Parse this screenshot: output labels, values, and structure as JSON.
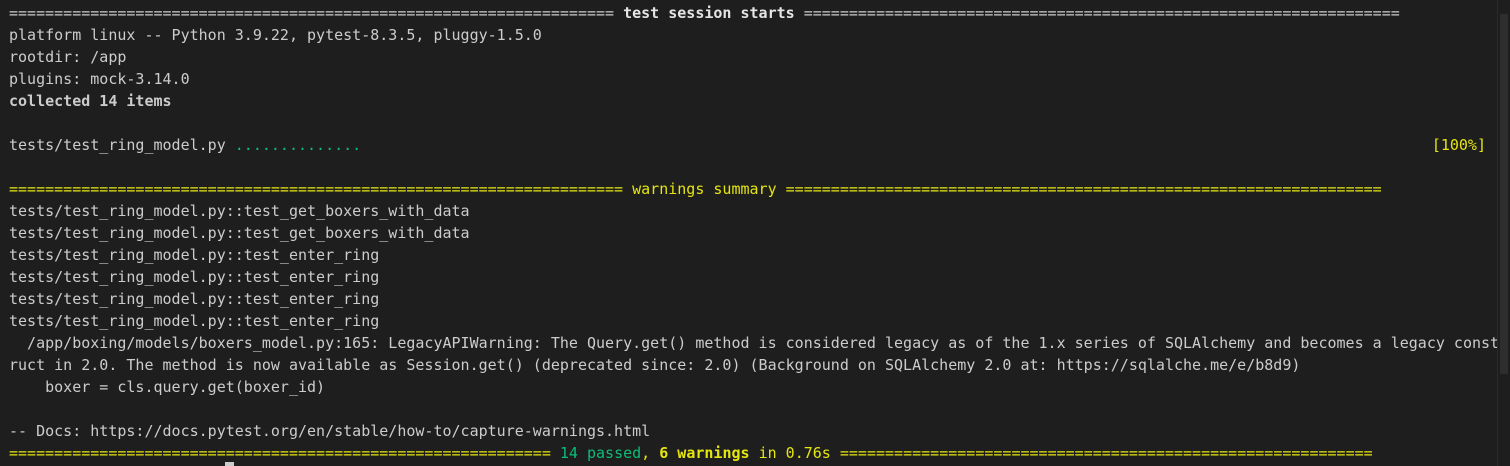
{
  "session": {
    "separator_left": "===================================================================",
    "title": " test session starts ",
    "separator_right": "=================================================================="
  },
  "header_lines": {
    "platform": "platform linux -- Python 3.9.22, pytest-8.3.5, pluggy-1.5.0",
    "rootdir": "rootdir: /app",
    "plugins": "plugins: mock-3.14.0",
    "collected": "collected 14 items"
  },
  "progress": {
    "file": "tests/test_ring_model.py ",
    "dots": "..............",
    "percent": "[100%]"
  },
  "warnings": {
    "separator_left": "====================================================================",
    "title": " warnings summary ",
    "separator_right": "==================================================================",
    "tests": [
      "tests/test_ring_model.py::test_get_boxers_with_data",
      "tests/test_ring_model.py::test_get_boxers_with_data",
      "tests/test_ring_model.py::test_enter_ring",
      "tests/test_ring_model.py::test_enter_ring",
      "tests/test_ring_model.py::test_enter_ring",
      "tests/test_ring_model.py::test_enter_ring"
    ],
    "message_line1": "  /app/boxing/models/boxers_model.py:165: LegacyAPIWarning: The Query.get() method is considered legacy as of the 1.x series of SQLAlchemy and becomes a legacy const",
    "message_line2": "ruct in 2.0. The method is now available as Session.get() (deprecated since: 2.0) (Background on SQLAlchemy 2.0 at: https://sqlalche.me/e/b8d9)",
    "code_line": "    boxer = cls.query.get(boxer_id)",
    "docs": "-- Docs: https://docs.pytest.org/en/stable/how-to/capture-warnings.html"
  },
  "summary": {
    "separator_left": "============================================================ ",
    "passed": "14 passed",
    "comma": ", ",
    "warnings": "6 warnings",
    "duration": " in 0.76s",
    "separator_right": " ==========================================================="
  },
  "colors": {
    "background": "#1e1e1e",
    "text": "#cccccc",
    "green": "#0dbc79",
    "yellow": "#e5e510"
  }
}
